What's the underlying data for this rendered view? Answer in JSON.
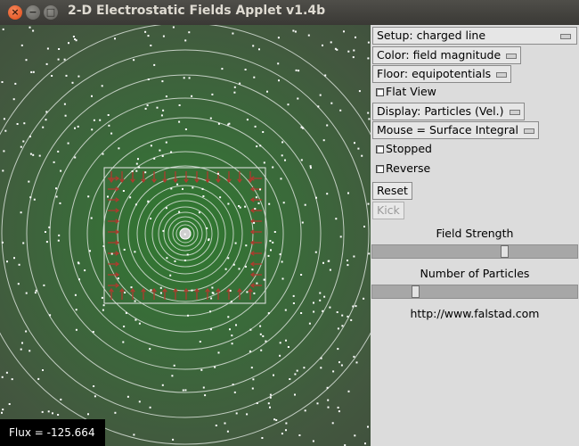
{
  "window": {
    "title": "2-D Electrostatic Fields Applet v1.4b",
    "close_glyph": "×",
    "minimize_glyph": "−",
    "maximize_glyph": "□"
  },
  "canvas": {
    "flux_readout": "Flux = -125.664"
  },
  "controls": {
    "setup": "Setup: charged line",
    "color": "Color: field magnitude",
    "floor": "Floor: equipotentials",
    "flat_view": "Flat View",
    "display": "Display: Particles (Vel.)",
    "mouse": "Mouse = Surface Integral",
    "stopped": "Stopped",
    "reverse": "Reverse",
    "reset": "Reset",
    "kick": "Kick",
    "field_strength_label": "Field Strength",
    "field_strength_value": 0.65,
    "particles_label": "Number of Particles",
    "particles_value": 0.2,
    "url": "http://www.falstad.com"
  }
}
